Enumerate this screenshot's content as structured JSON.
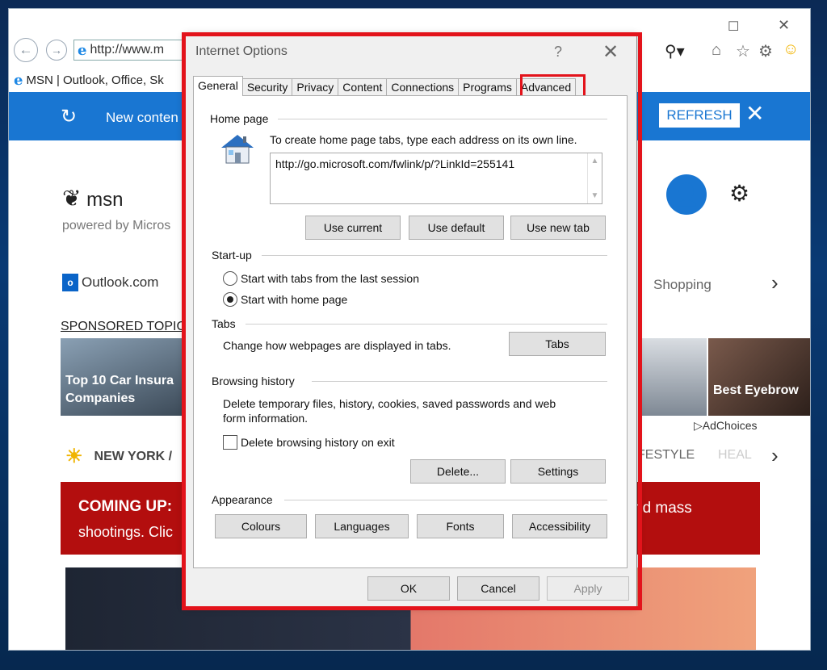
{
  "browser": {
    "address": "http://www.m",
    "tab_title": "MSN | Outlook, Office, Sk",
    "banner_text": "New conten",
    "refresh_label": "REFRESH",
    "msn_logo": "msn",
    "powered_by": "powered by Micros",
    "outlook_label": "Outlook.com",
    "shopping_label": "Shopping",
    "sponsored": "SPONSORED TOPIC",
    "tile1": "Top 10 Car Insura Companies",
    "tile3": "Best Eyebrow",
    "adchoices": "AdChoices",
    "weather": "NEW YORK /",
    "lifestyle": "FESTYLE",
    "health": "HEAL",
    "coming_line1": "COMING UP:",
    "coming_line2": "shootings. Clic",
    "coming_right": "nd mass"
  },
  "dialog": {
    "title": "Internet Options",
    "help": "?",
    "close": "✕",
    "tabs": [
      "General",
      "Security",
      "Privacy",
      "Content",
      "Connections",
      "Programs",
      "Advanced"
    ],
    "home_page": {
      "heading": "Home page",
      "instructions": "To create home page tabs, type each address on its own line.",
      "url": "http://go.microsoft.com/fwlink/p/?LinkId=255141",
      "use_current": "Use current",
      "use_default": "Use default",
      "use_new_tab": "Use new tab"
    },
    "startup": {
      "heading": "Start-up",
      "option1": "Start with tabs from the last session",
      "option2": "Start with home page",
      "selected": "Start with home page"
    },
    "tabs_group": {
      "heading": "Tabs",
      "description": "Change how webpages are displayed in tabs.",
      "button": "Tabs"
    },
    "browsing_history": {
      "heading": "Browsing history",
      "description_line1": "Delete temporary files, history, cookies, saved passwords and web",
      "description_line2": "form information.",
      "checkbox": "Delete browsing history on exit",
      "checked": false,
      "delete": "Delete...",
      "settings": "Settings"
    },
    "appearance": {
      "heading": "Appearance",
      "colours": "Colours",
      "languages": "Languages",
      "fonts": "Fonts",
      "accessibility": "Accessibility"
    },
    "footer": {
      "ok": "OK",
      "cancel": "Cancel",
      "apply": "Apply"
    }
  }
}
